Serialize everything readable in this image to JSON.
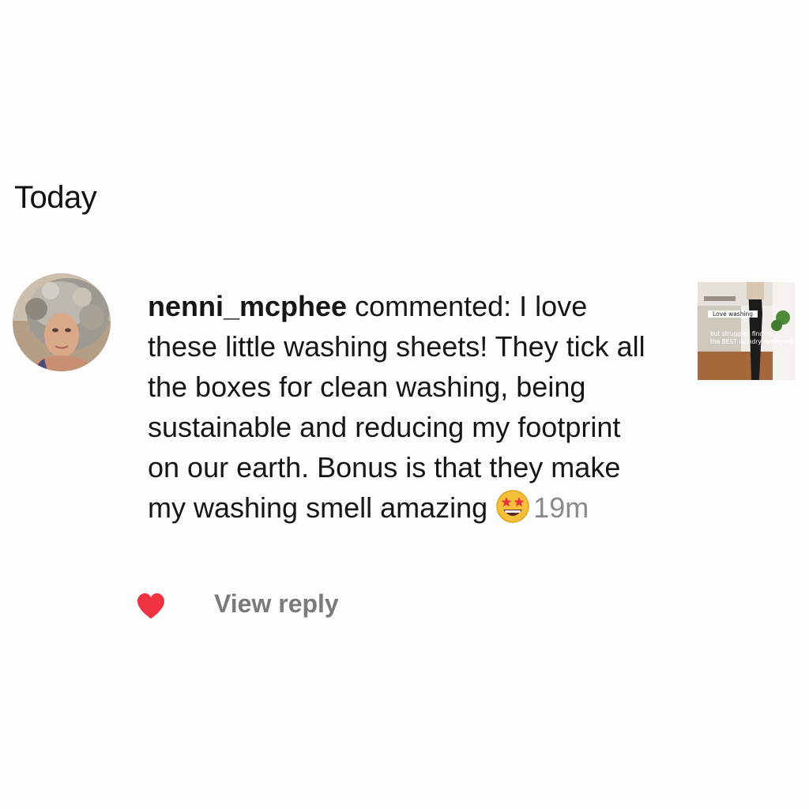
{
  "section": {
    "title": "Today"
  },
  "notification": {
    "username": "nenni_mcphee",
    "action": " commented: ",
    "comment": "I love these little washing sheets! They tick all the boxes for clean washing, being sustainable and reducing my footprint on our earth. Bonus is that they make my washing smell amazing",
    "emoji": "star-struck-emoji",
    "time": "19m",
    "avatar_icon": "user-avatar",
    "thumbnail": {
      "caption_line1": "Love washing",
      "caption_line2": "but struggled finding",
      "caption_line3": "the BEST laundry detergent"
    }
  },
  "actions": {
    "like_icon": "heart-icon",
    "like_color": "#ef3340",
    "view_reply_label": "View reply"
  }
}
